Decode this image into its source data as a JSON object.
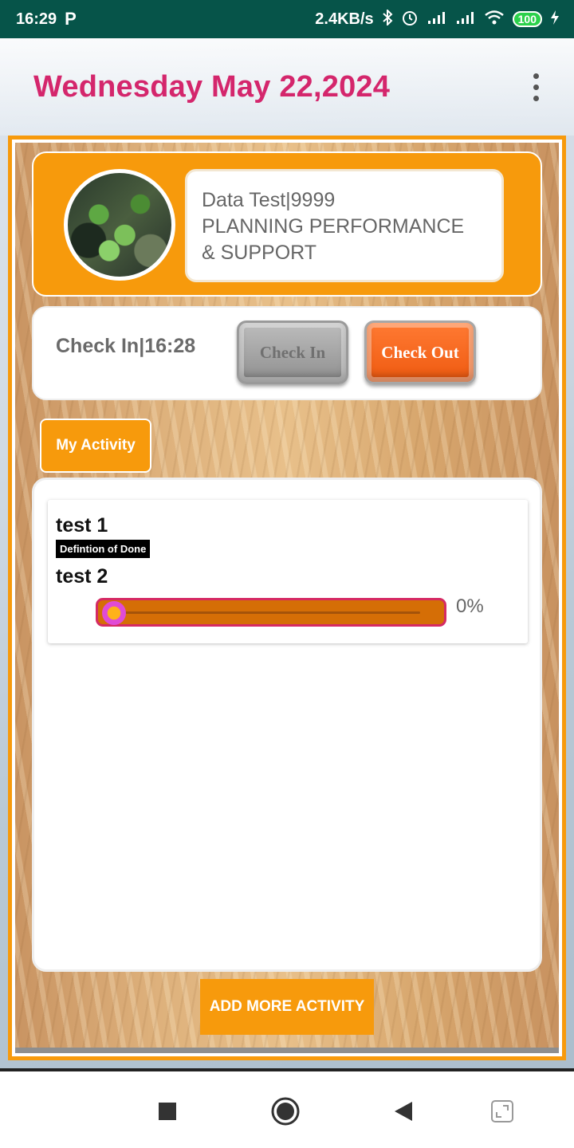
{
  "status_bar": {
    "time": "16:29",
    "p_glyph": "P",
    "net_speed": "2.4KB/s",
    "battery": "100",
    "icons": [
      "bluetooth-icon",
      "alarm-icon",
      "signal-icon",
      "signal-icon",
      "wifi-icon",
      "battery-icon",
      "charging-icon"
    ]
  },
  "header": {
    "date": "Wednesday May 22,2024",
    "menu_icon": "more-vert-icon"
  },
  "profile": {
    "name_line": "Data Test|9999",
    "department_line1": "PLANNING PERFORMANCE",
    "department_line2": "& SUPPORT"
  },
  "check": {
    "status": "Check In|16:28",
    "check_in_label": "Check In",
    "check_out_label": "Check Out"
  },
  "activity_tab": {
    "label": "My Activity"
  },
  "activity": {
    "items": [
      {
        "title": "test 1",
        "badge": "Defintion of Done",
        "subtitle": "test 2",
        "progress": 0,
        "progress_label": "0%"
      }
    ]
  },
  "add_button": {
    "label": "ADD MORE ACTIVITY"
  },
  "nav": {
    "icons": [
      "recents-icon",
      "home-icon",
      "back-icon",
      "expand-icon"
    ]
  },
  "colors": {
    "accent_orange": "#f79a0c",
    "date_pink": "#d4266c",
    "status_green": "#065449",
    "checkout_orange": "#ef5a10"
  }
}
